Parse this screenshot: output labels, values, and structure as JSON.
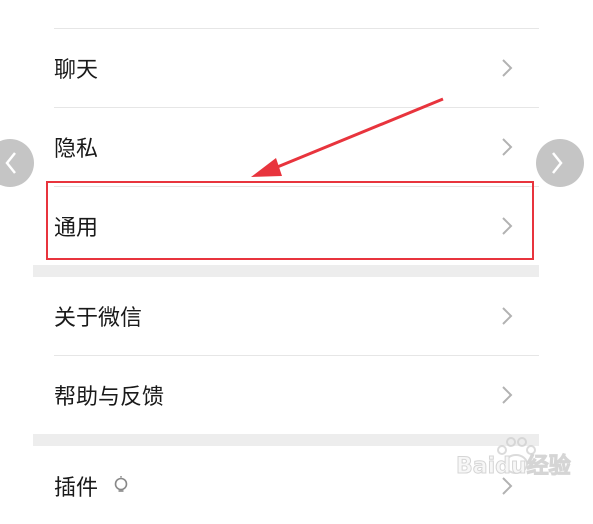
{
  "settings": {
    "items": [
      {
        "label": "聊天"
      },
      {
        "label": "隐私"
      },
      {
        "label": "通用"
      },
      {
        "label": "关于微信"
      },
      {
        "label": "帮助与反馈"
      },
      {
        "label": "插件"
      }
    ]
  },
  "icons": {
    "chevron": "chevron-right-icon",
    "prev": "chevron-left-icon",
    "next": "chevron-right-icon",
    "plugin": "bulb-icon"
  },
  "colors": {
    "highlight": "#e8343d",
    "background": "#ededed",
    "row": "#ffffff"
  },
  "watermark": {
    "brand": "Baidu经验"
  }
}
